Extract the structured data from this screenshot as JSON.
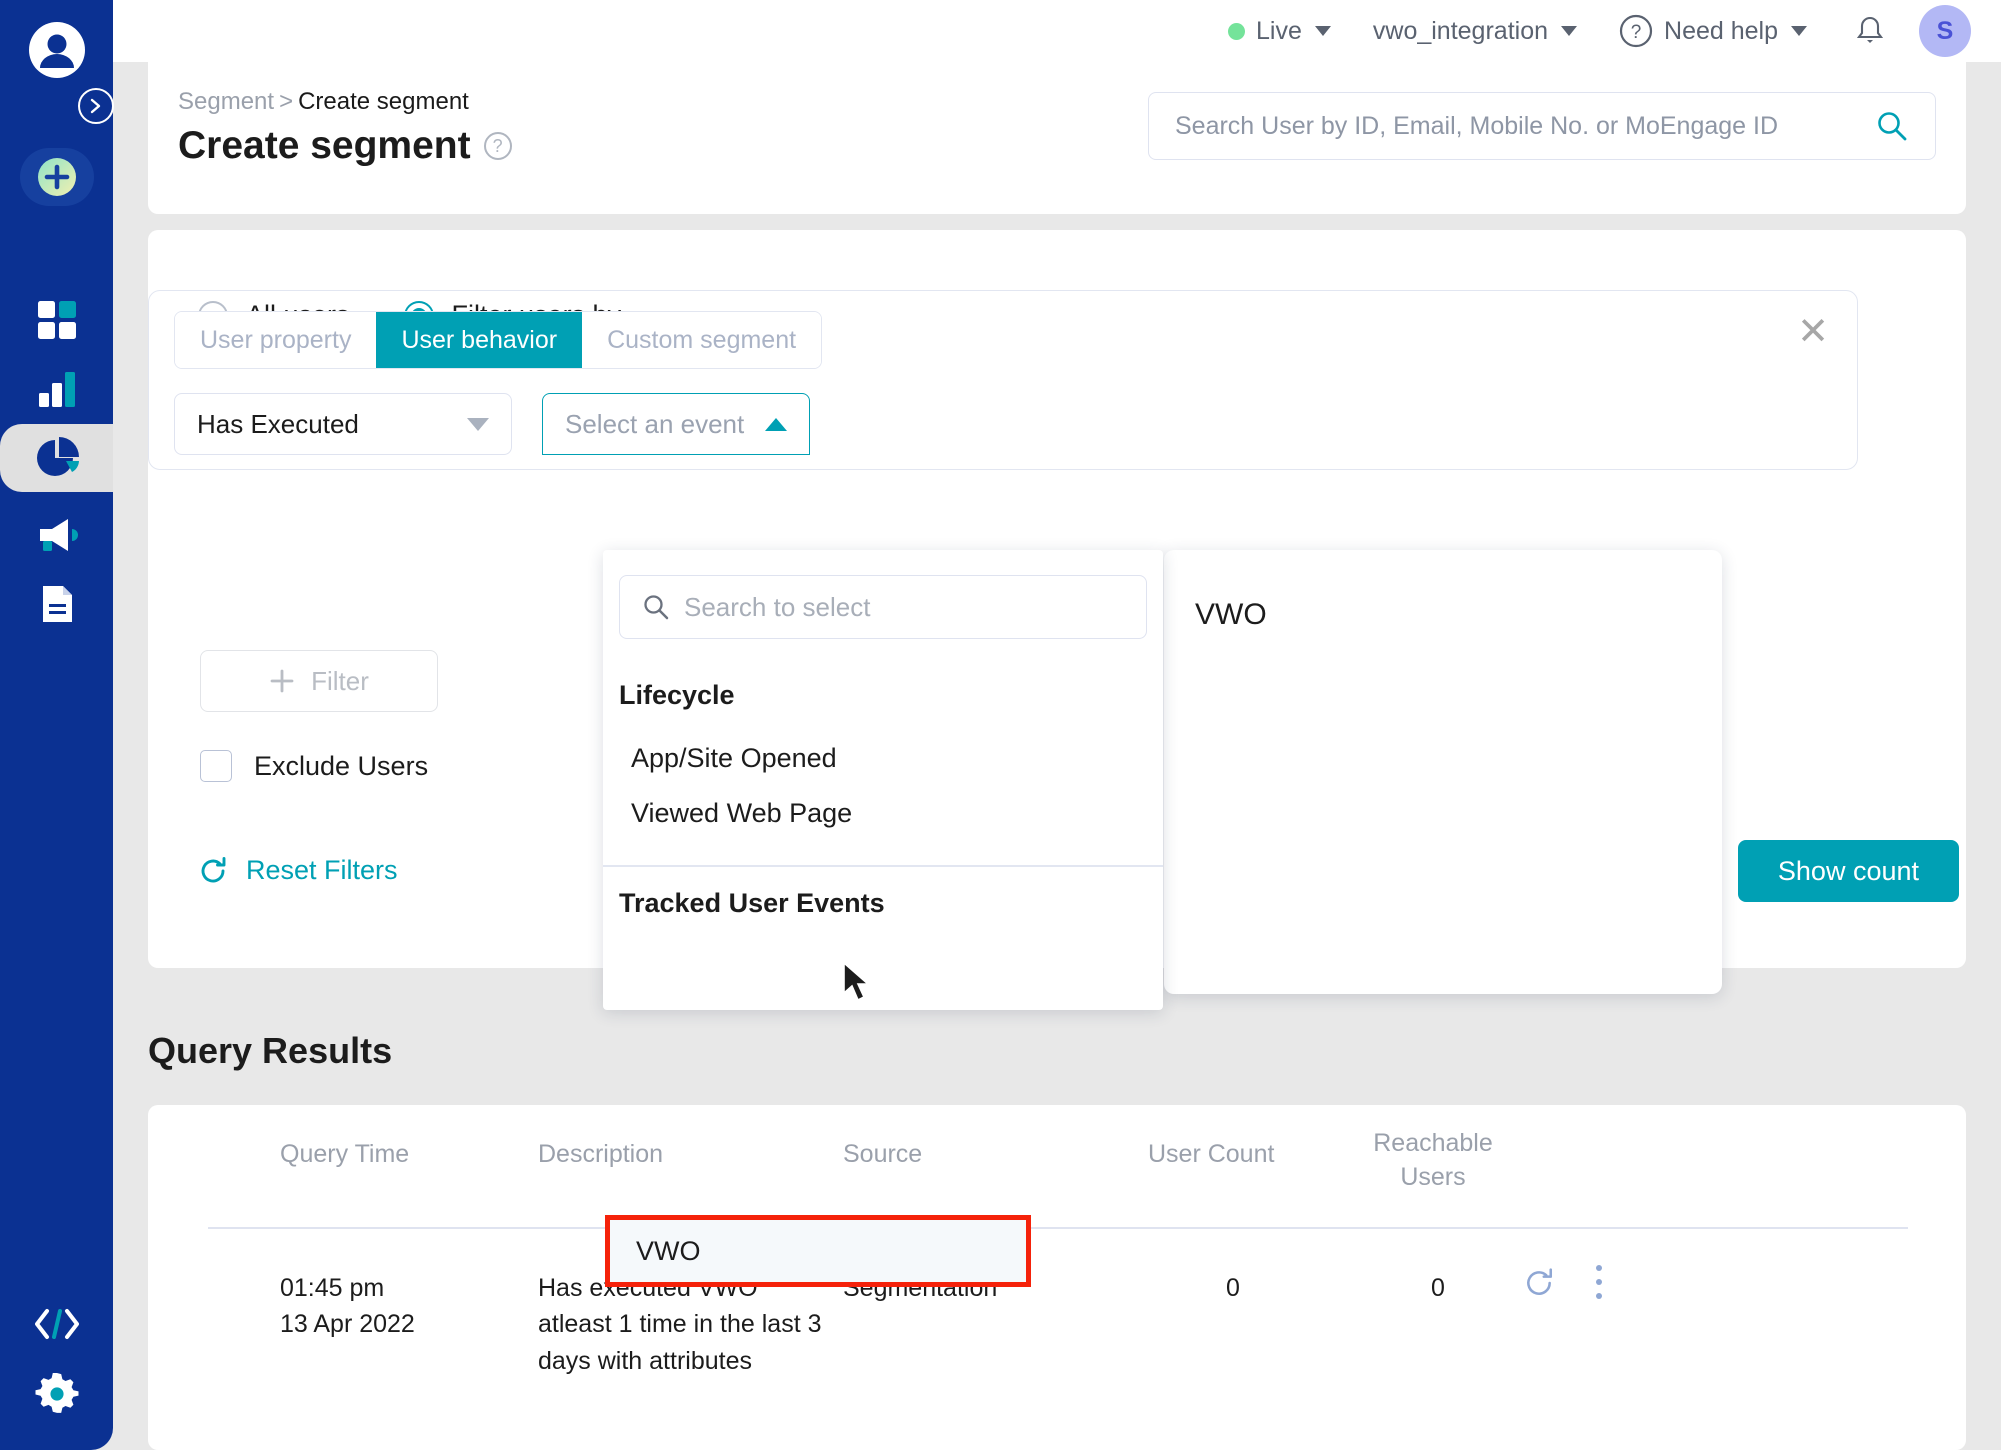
{
  "topbar": {
    "env_label": "Live",
    "workspace_label": "vwo_integration",
    "help_label": "Need help",
    "avatar_initial": "S",
    "icons": {
      "help": "question-circle-icon",
      "bell": "notification-bell-icon"
    },
    "colors": {
      "live_dot": "#74e39a",
      "avatar_bg": "#b3b8f5"
    }
  },
  "sidebar": {
    "items": [
      {
        "name": "logo",
        "icon": "user-avatar-logo"
      },
      {
        "name": "expand",
        "icon": "chevron-right-icon"
      },
      {
        "name": "create",
        "icon": "plus-circle-icon"
      },
      {
        "name": "dashboard",
        "icon": "grid-squares-icon"
      },
      {
        "name": "analytics",
        "icon": "bar-chart-icon"
      },
      {
        "name": "segments",
        "icon": "pie-chart-icon",
        "active": true
      },
      {
        "name": "campaigns",
        "icon": "megaphone-icon"
      },
      {
        "name": "content",
        "icon": "document-icon"
      },
      {
        "name": "developer",
        "icon": "code-brackets-icon"
      },
      {
        "name": "settings",
        "icon": "gear-icon"
      }
    ],
    "colors": {
      "bg": "#0b3192",
      "accent": "#00a0b4",
      "active_bg": "#e0e0e0"
    }
  },
  "header": {
    "breadcrumb_parent": "Segment",
    "breadcrumb_sep": ">",
    "breadcrumb_current": "Create segment",
    "page_title": "Create segment",
    "help_icon": "question-mark-icon"
  },
  "search": {
    "placeholder": "Search User by ID, Email, Mobile No. or MoEngage ID",
    "value": "",
    "icon": "search-icon"
  },
  "filters": {
    "radio_all_users": "All users",
    "radio_filter_users": "Filter users by",
    "selected_radio": "Filter users by",
    "tabs": [
      {
        "label": "User property",
        "active": false
      },
      {
        "label": "User behavior",
        "active": true
      },
      {
        "label": "Custom segment",
        "active": false
      }
    ],
    "condition_select_value": "Has Executed",
    "event_select_placeholder": "Select an event",
    "close_icon": "close-x-icon",
    "add_filter_label": "Filter",
    "add_filter_icon": "plus-icon",
    "exclude_users_label": "Exclude Users",
    "exclude_users_checked": false,
    "reset_filters_label": "Reset Filters",
    "reset_icon": "refresh-icon",
    "show_count_label": "Show count",
    "accent_color": "#00a0b4"
  },
  "event_dropdown": {
    "search_placeholder": "Search to select",
    "search_value": "",
    "search_icon": "search-icon",
    "groups": [
      {
        "title": "Lifecycle",
        "options": [
          "App/Site Opened",
          "Viewed Web Page"
        ]
      },
      {
        "title": "Tracked User Events",
        "options": [
          "VWO"
        ]
      }
    ],
    "highlighted_option": "VWO",
    "highlight_color": "#f5220a",
    "detail_panel_label": "VWO"
  },
  "query_results": {
    "section_title": "Query Results",
    "columns": [
      "Query Time",
      "Description",
      "Source",
      "User Count",
      "Reachable Users"
    ],
    "rows": [
      {
        "query_time_line1": "01:45 pm",
        "query_time_line2": "13 Apr 2022",
        "description": "Has executed VWO atleast 1 time in the last 3 days with attributes",
        "source": "Segmentation",
        "user_count": "0",
        "reachable_users": "0",
        "refresh_icon": "refresh-icon",
        "menu_icon": "kebab-menu-icon"
      }
    ]
  }
}
